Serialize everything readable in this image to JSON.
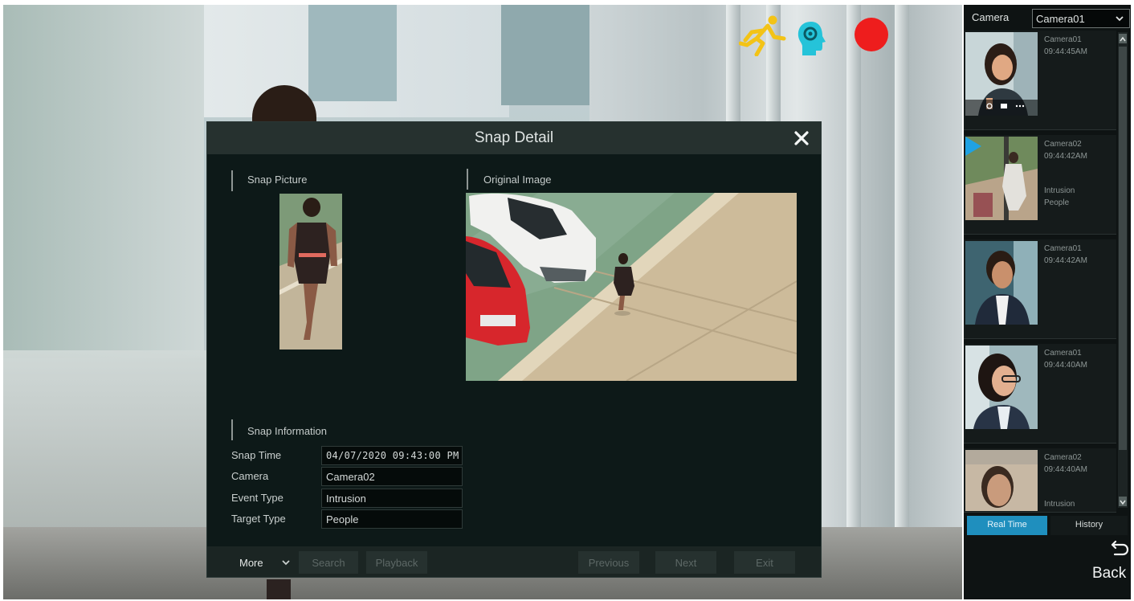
{
  "dialog": {
    "title": "Snap Detail",
    "snap_picture_label": "Snap Picture",
    "original_image_label": "Original Image",
    "snap_information_label": "Snap Information",
    "fields": [
      {
        "label": "Snap Time",
        "value": "04/07/2020 09:43:00 PM"
      },
      {
        "label": "Camera",
        "value": "Camera02"
      },
      {
        "label": "Event Type",
        "value": "Intrusion"
      },
      {
        "label": "Target Type",
        "value": "People"
      }
    ],
    "footer": {
      "more": "More",
      "search": "Search",
      "playback": "Playback",
      "previous": "Previous",
      "next": "Next",
      "exit": "Exit"
    }
  },
  "panel": {
    "camera_label": "Camera",
    "camera_selected": "Camera01",
    "cards": [
      {
        "camera": "Camera01",
        "time": "09:44:45AM",
        "event": "",
        "target": ""
      },
      {
        "camera": "Camera02",
        "time": "09:44:42AM",
        "event": "Intrusion",
        "target": "People"
      },
      {
        "camera": "Camera01",
        "time": "09:44:42AM",
        "event": "",
        "target": ""
      },
      {
        "camera": "Camera01",
        "time": "09:44:40AM",
        "event": "",
        "target": ""
      },
      {
        "camera": "Camera02",
        "time": "09:44:40AM",
        "event": "Intrusion",
        "target": ""
      }
    ],
    "tabs": {
      "real_time": "Real Time",
      "history": "History"
    },
    "back": "Back"
  },
  "status_icons": [
    "running-person-icon",
    "face-detection-icon",
    "record-icon"
  ],
  "colors": {
    "accent_tab": "#1f8fbe",
    "record": "#ee1d1d",
    "motion": "#f3c316",
    "face": "#25c3d9"
  }
}
